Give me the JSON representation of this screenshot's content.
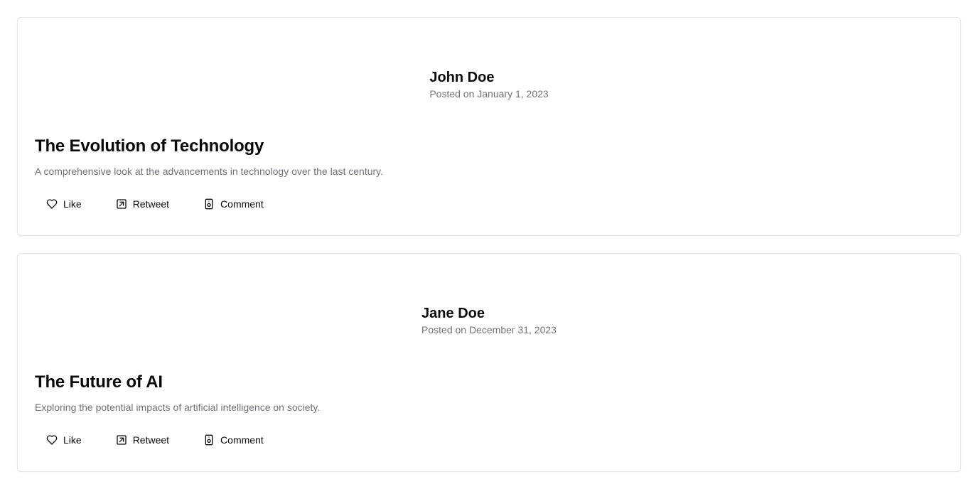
{
  "posts": [
    {
      "author": "John Doe",
      "date": "Posted on January 1, 2023",
      "title": "The Evolution of Technology",
      "description": "A comprehensive look at the advancements in technology over the last century.",
      "actions": {
        "like": "Like",
        "retweet": "Retweet",
        "comment": "Comment"
      }
    },
    {
      "author": "Jane Doe",
      "date": "Posted on December 31, 2023",
      "title": "The Future of AI",
      "description": "Exploring the potential impacts of artificial intelligence on society.",
      "actions": {
        "like": "Like",
        "retweet": "Retweet",
        "comment": "Comment"
      }
    }
  ],
  "icons": {
    "like": "heart-icon",
    "retweet": "share-arrow-icon",
    "comment": "comment-icon"
  },
  "colors": {
    "text": "#0a0a0a",
    "muted": "#71717a",
    "border": "#e4e4e7"
  }
}
